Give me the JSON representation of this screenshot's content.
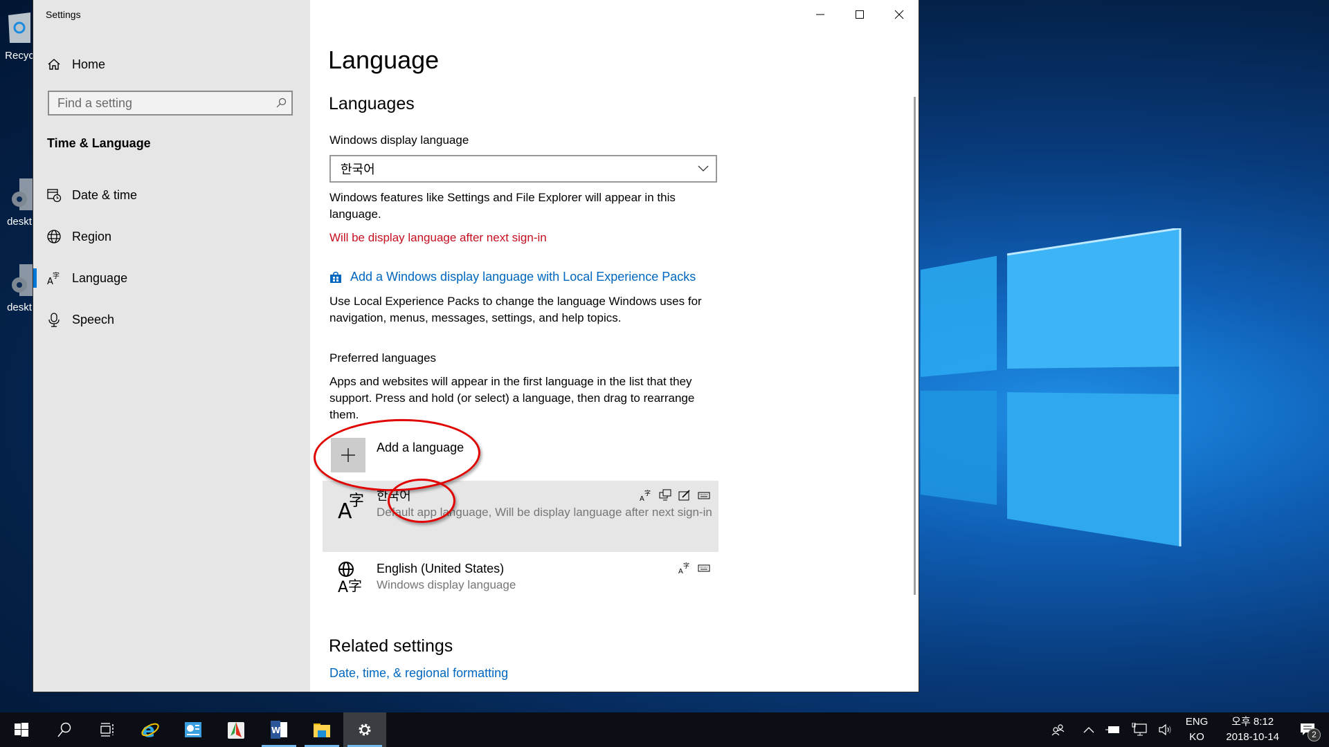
{
  "desktop": {
    "icons": [
      {
        "label": "Recyc",
        "icon": "recycle-bin-icon"
      },
      {
        "label": "deskt",
        "icon": "settings-gear-icon"
      },
      {
        "label": "deskt",
        "icon": "settings-gear-icon"
      }
    ]
  },
  "window": {
    "title": "Settings",
    "controls": {
      "minimize": "minimize-icon",
      "maximize": "maximize-icon",
      "close": "close-icon"
    }
  },
  "sidebar": {
    "home_label": "Home",
    "search_placeholder": "Find a setting",
    "section_title": "Time & Language",
    "items": [
      {
        "label": "Date & time",
        "icon": "calendar-clock-icon",
        "active": false
      },
      {
        "label": "Region",
        "icon": "globe-icon",
        "active": false
      },
      {
        "label": "Language",
        "icon": "language-icon",
        "active": true
      },
      {
        "label": "Speech",
        "icon": "microphone-icon",
        "active": false
      }
    ]
  },
  "main": {
    "page_title": "Language",
    "languages_heading": "Languages",
    "display_language_label": "Windows display language",
    "display_language_value": "한국어",
    "display_language_desc": "Windows features like Settings and File Explorer will appear in this language.",
    "display_language_warning": "Will be display language after next sign-in",
    "lxp_link": "Add a Windows display language with Local Experience Packs",
    "lxp_desc": "Use Local Experience Packs to change the language Windows uses for navigation, menus, messages, settings, and help topics.",
    "preferred_label": "Preferred languages",
    "preferred_desc": "Apps and websites will appear in the first language in the list that they support. Press and hold (or select) a language, then drag to rearrange them.",
    "add_language_label": "Add a language",
    "languages": [
      {
        "name": "한국어",
        "desc": "Default app language, Will be display language after next sign-in",
        "features": [
          "language-pack-icon",
          "display-language-icon",
          "handwriting-icon",
          "keyboard-icon"
        ],
        "selected": true
      },
      {
        "name": "English (United States)",
        "desc": "Windows display language",
        "features": [
          "language-pack-icon",
          "keyboard-icon"
        ],
        "selected": false
      }
    ],
    "related_heading": "Related settings",
    "related_link": "Date, time, & regional formatting"
  },
  "taskbar": {
    "apps": [
      "start",
      "search",
      "task-view",
      "internet-explorer",
      "control-panel",
      "app-red-green",
      "word",
      "file-explorer",
      "settings"
    ],
    "tray": {
      "input_lang_top": "ENG",
      "input_lang_bottom": "KO",
      "time": "오후 8:12",
      "date": "2018-10-14",
      "notification_count": "2"
    }
  },
  "colors": {
    "accent": "#0078d7",
    "link": "#0067c0",
    "warning": "#c50f1f",
    "annotation": "#e00000"
  }
}
